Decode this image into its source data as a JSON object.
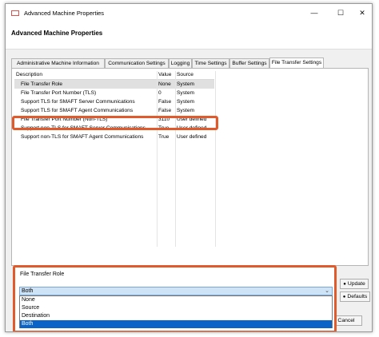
{
  "window": {
    "title": "Advanced Machine Properties",
    "minimize": "—",
    "maximize": "☐",
    "close": "✕"
  },
  "header": {
    "title": "Advanced Machine Properties"
  },
  "tabs": [
    {
      "label": "Administrative Machine Information"
    },
    {
      "label": "Communication Settings"
    },
    {
      "label": "Logging"
    },
    {
      "label": "Time Settings"
    },
    {
      "label": "Buffer Settings"
    },
    {
      "label": "File Transfer Settings",
      "active": true
    }
  ],
  "table": {
    "headers": {
      "description": "Description",
      "value": "Value",
      "source": "Source"
    },
    "rows": [
      {
        "description": "File Transfer Role",
        "value": "None",
        "source": "System",
        "selected": true
      },
      {
        "description": "File Transfer Port Number (TLS)",
        "value": "0",
        "source": "System"
      },
      {
        "description": "Support TLS for SMAFT Server Communications",
        "value": "False",
        "source": "System"
      },
      {
        "description": "Support TLS for SMAFT Agent Communications",
        "value": "False",
        "source": "System"
      },
      {
        "description": "File Transfer Port Number (Non-TLS)",
        "value": "3110",
        "source": "User defined"
      },
      {
        "description": "Support non-TLS for SMAFT Server Communications",
        "value": "True",
        "source": "User defined"
      },
      {
        "description": "Support non-TLS for SMAFT Agent Communications",
        "value": "True",
        "source": "User defined"
      }
    ]
  },
  "editor": {
    "label": "File Transfer Role",
    "selected": "Both",
    "options": [
      "None",
      "Source",
      "Destination",
      "Both"
    ]
  },
  "buttons": {
    "update": "Update",
    "defaults": "Defaults",
    "cancel": "Cancel"
  },
  "colors": {
    "highlight": "#e05a2b",
    "selection": "#0a64c8"
  }
}
